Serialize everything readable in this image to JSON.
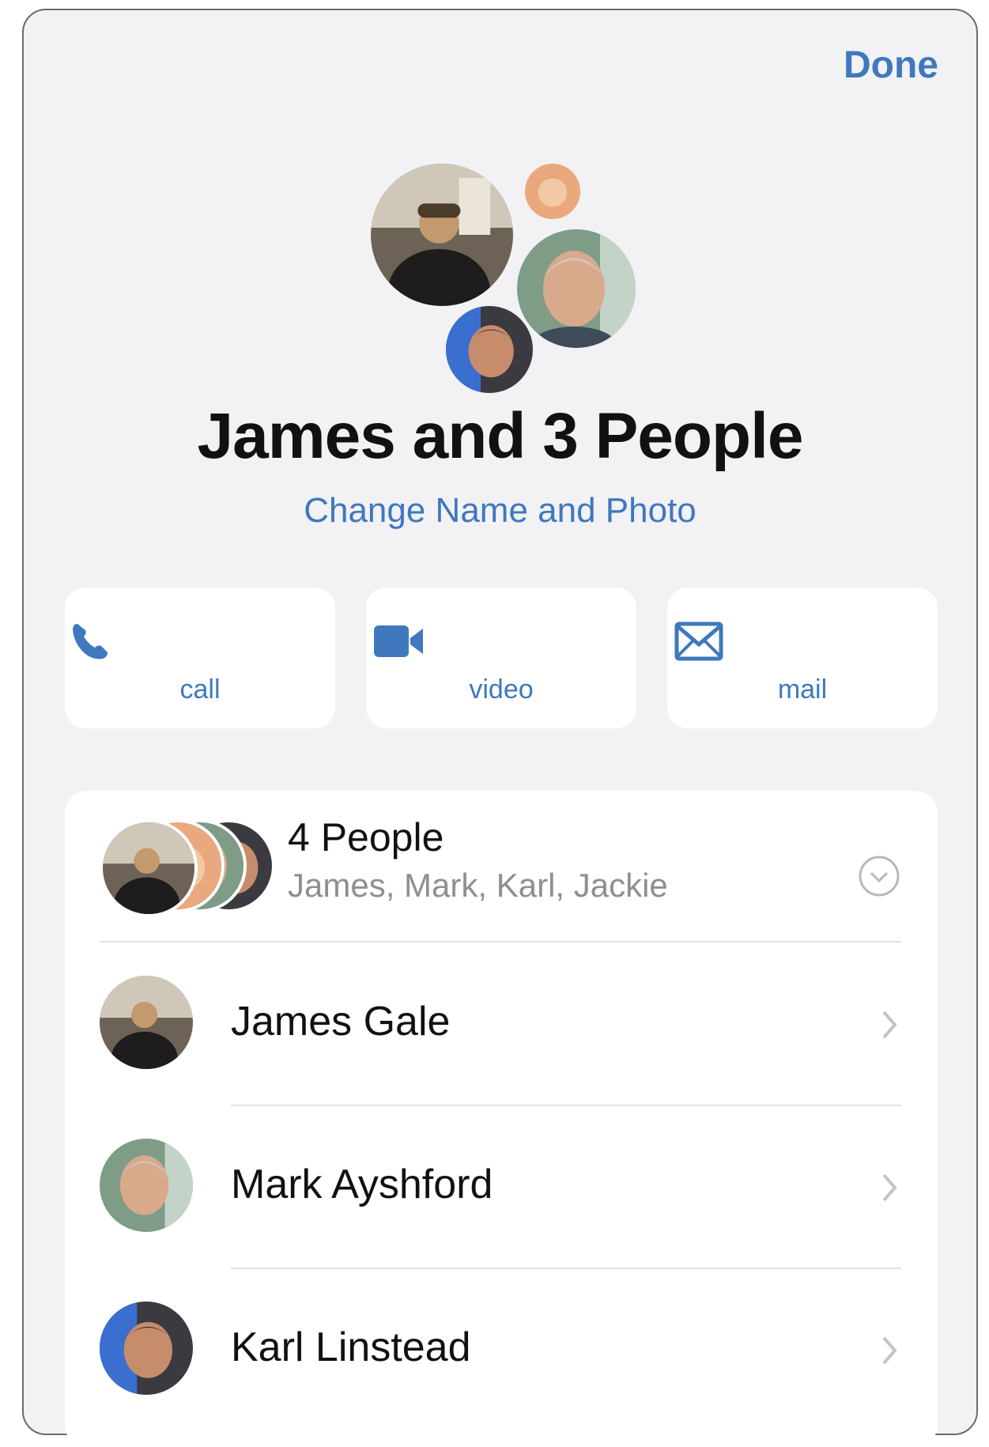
{
  "header": {
    "done_label": "Done"
  },
  "group": {
    "title": "James and 3 People",
    "change_label": "Change Name and Photo"
  },
  "actions": [
    {
      "label": "call",
      "icon": "phone-icon"
    },
    {
      "label": "video",
      "icon": "video-camera-icon"
    },
    {
      "label": "mail",
      "icon": "envelope-icon"
    }
  ],
  "members_summary": {
    "title": "4 People",
    "subtitle": "James, Mark, Karl, Jackie"
  },
  "contacts": [
    {
      "name": "James Gale"
    },
    {
      "name": "Mark Ayshford"
    },
    {
      "name": "Karl Linstead"
    }
  ],
  "colors": {
    "accent": "#3f78bd",
    "background": "#f2f1f4",
    "card": "#ffffff"
  }
}
